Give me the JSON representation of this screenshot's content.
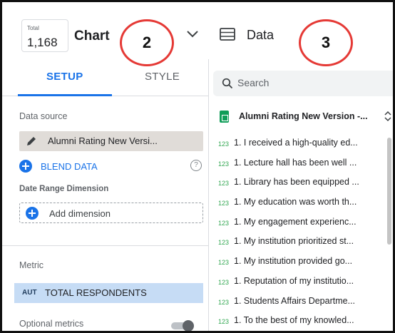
{
  "chart_panel": {
    "total_label": "Total",
    "total_value": "1,168",
    "title": "Chart",
    "tabs": [
      {
        "label": "SETUP",
        "active": true
      },
      {
        "label": "STYLE",
        "active": false
      }
    ],
    "data_source_label": "Data source",
    "data_source_name": "Alumni Rating New Versi...",
    "blend_label": "BLEND DATA",
    "help_glyph": "?",
    "date_range_label": "Date Range Dimension",
    "add_dimension_label": "Add dimension",
    "metric_label": "Metric",
    "metric_agg": "AUT",
    "metric_name": "TOTAL RESPONDENTS",
    "optional_metrics_label": "Optional metrics",
    "optional_metrics_on": false
  },
  "data_panel": {
    "title": "Data",
    "search_placeholder": "Search",
    "source_name": "Alumni Rating New Version -...",
    "field_type": "123",
    "fields": [
      "1. I received a high-quality ed...",
      "1. Lecture hall has been well ...",
      "1. Library has been equipped ...",
      "1. My education was worth th...",
      "1. My engagement experienc...",
      "1. My institution prioritized st...",
      "1. My institution provided go...",
      "1. Reputation of my institutio...",
      "1. Students Affairs Departme...",
      "1. To the best of my knowled..."
    ]
  },
  "annotations": [
    "2",
    "3"
  ],
  "colors": {
    "accent": "#1a73e8",
    "callout": "#e53935",
    "metric_chip": "#c6dcf5",
    "field_type": "#34a853"
  }
}
